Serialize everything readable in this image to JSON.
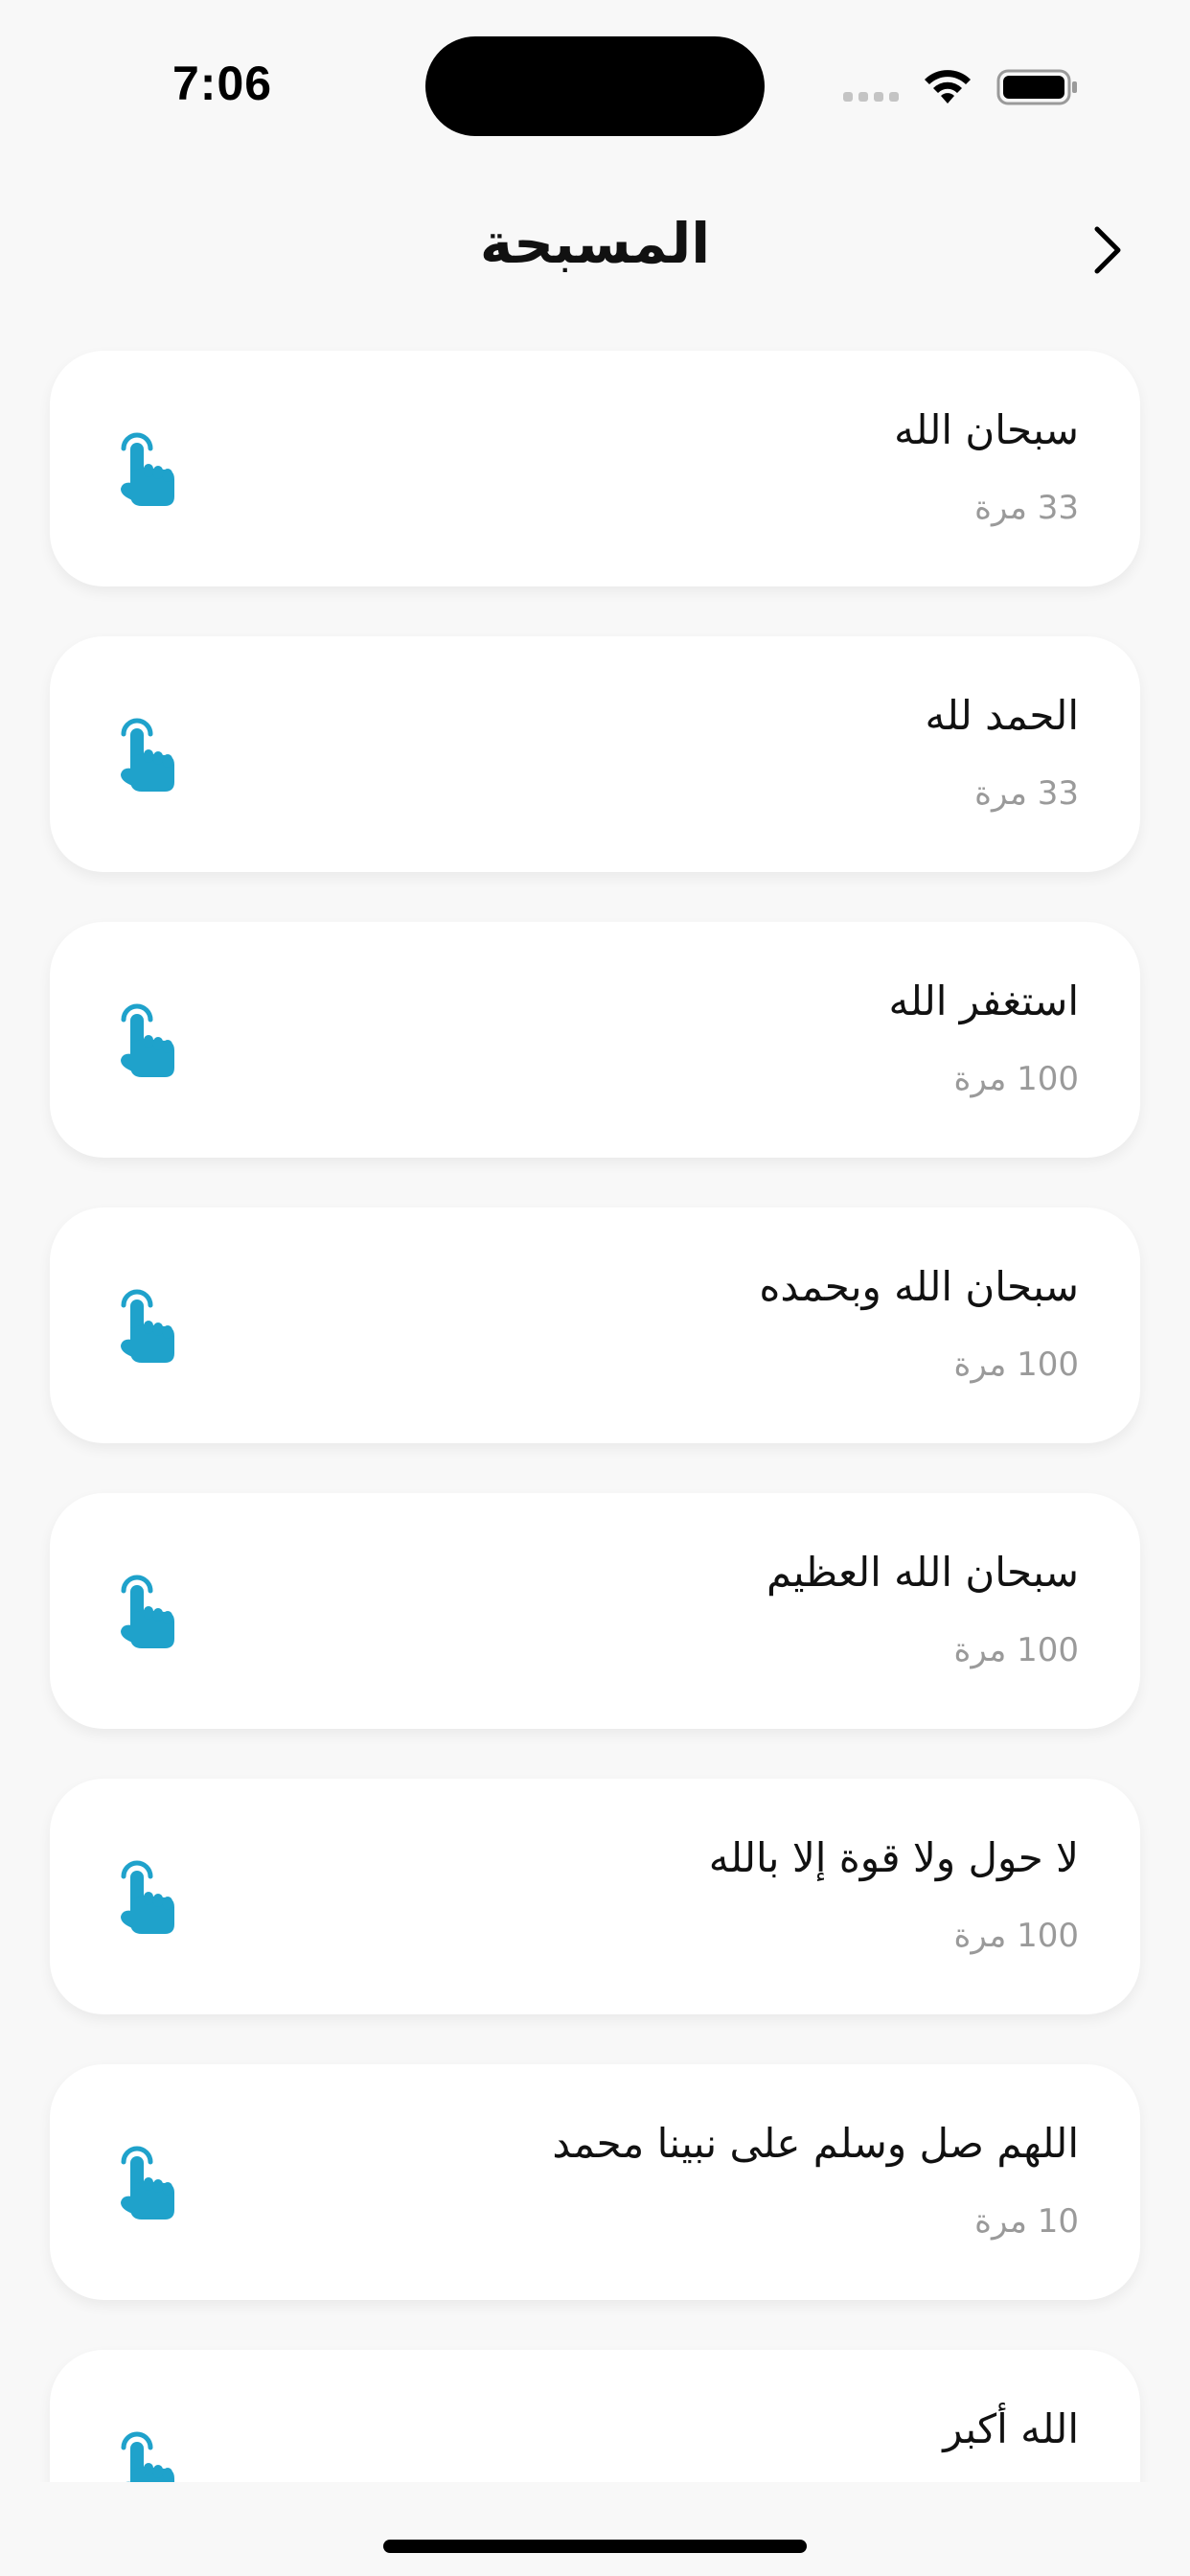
{
  "status_bar": {
    "time": "7:06"
  },
  "header": {
    "title": "المسبحة",
    "back_icon": "chevron-right-icon"
  },
  "colors": {
    "accent": "#1fa2cb",
    "background": "#f8f8f8",
    "card": "#ffffff",
    "muted_text": "#9a9a9a"
  },
  "dhikr_list": [
    {
      "text": "سبحان الله",
      "count": "33 مرة",
      "icon": "tap-finger-icon"
    },
    {
      "text": "الحمد لله",
      "count": "33 مرة",
      "icon": "tap-finger-icon"
    },
    {
      "text": "استغفر الله",
      "count": "100 مرة",
      "icon": "tap-finger-icon"
    },
    {
      "text": "سبحان الله وبحمده",
      "count": "100 مرة",
      "icon": "tap-finger-icon"
    },
    {
      "text": "سبحان الله العظيم",
      "count": "100 مرة",
      "icon": "tap-finger-icon"
    },
    {
      "text": "لا حول ولا قوة إلا بالله",
      "count": "100 مرة",
      "icon": "tap-finger-icon"
    },
    {
      "text": "اللهم صل وسلم على نبينا محمد",
      "count": "10 مرة",
      "icon": "tap-finger-icon"
    },
    {
      "text": "الله أكبر",
      "count": "",
      "icon": "tap-finger-icon"
    }
  ]
}
